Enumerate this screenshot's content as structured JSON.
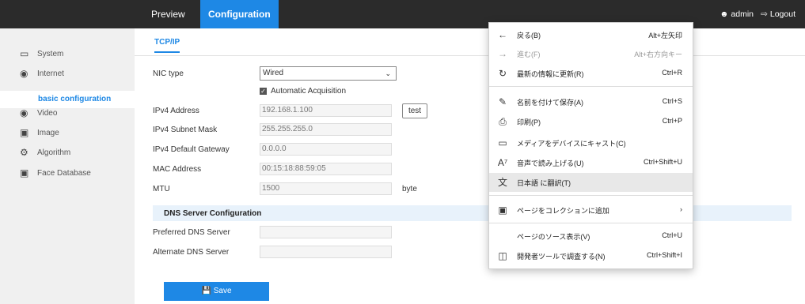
{
  "topbar": {
    "tabs": [
      {
        "label": "Preview"
      },
      {
        "label": "Configuration"
      }
    ],
    "user": "admin",
    "logout": "Logout"
  },
  "sidebar": {
    "items": [
      {
        "label": "System",
        "icon": "monitor-icon"
      },
      {
        "label": "Internet",
        "icon": "globe-icon"
      },
      {
        "label": "Video",
        "icon": "camera-icon"
      },
      {
        "label": "Image",
        "icon": "image-icon"
      },
      {
        "label": "Algorithm",
        "icon": "gears-icon"
      },
      {
        "label": "Face Database",
        "icon": "face-scan-icon"
      }
    ],
    "active_sub": "basic configuration"
  },
  "subtab": "TCP/IP",
  "form": {
    "nic_label": "NIC type",
    "nic_value": "Wired",
    "auto_label": "Automatic Acquisition",
    "ipv4_label": "IPv4 Address",
    "ipv4_value": "192.168.1.100",
    "test_label": "test",
    "mask_label": "IPv4 Subnet Mask",
    "mask_value": "255.255.255.0",
    "gateway_label": "IPv4 Default Gateway",
    "gateway_value": "0.0.0.0",
    "mac_label": "MAC Address",
    "mac_value": "00:15:18:88:59:05",
    "mtu_label": "MTU",
    "mtu_value": "1500",
    "mtu_unit": "byte",
    "dns_title": "DNS Server Configuration",
    "pref_dns_label": "Preferred DNS Server",
    "pref_dns_value": "",
    "alt_dns_label": "Alternate DNS Server",
    "alt_dns_value": "",
    "save_label": "Save"
  },
  "context_menu": {
    "items": [
      {
        "label": "戻る(B)",
        "shortcut": "Alt+左矢印",
        "icon": "back-arrow-icon"
      },
      {
        "label": "進む(F)",
        "shortcut": "Alt+右方向キー",
        "icon": "forward-arrow-icon"
      },
      {
        "label": "最新の情報に更新(R)",
        "shortcut": "Ctrl+R",
        "icon": "refresh-icon"
      },
      {
        "label": "名前を付けて保存(A)",
        "shortcut": "Ctrl+S",
        "icon": "save-as-icon"
      },
      {
        "label": "印刷(P)",
        "shortcut": "Ctrl+P",
        "icon": "print-icon"
      },
      {
        "label": "メディアをデバイスにキャスト(C)",
        "shortcut": "",
        "icon": "cast-icon"
      },
      {
        "label": "音声で読み上げる(U)",
        "shortcut": "Ctrl+Shift+U",
        "icon": "read-aloud-icon"
      },
      {
        "label": "日本語 に翻訳(T)",
        "shortcut": "",
        "icon": "translate-icon"
      },
      {
        "label": "ページをコレクションに追加",
        "shortcut": "",
        "icon": "collections-icon"
      },
      {
        "label": "ページのソース表示(V)",
        "shortcut": "Ctrl+U",
        "icon": ""
      },
      {
        "label": "開発者ツールで調査する(N)",
        "shortcut": "Ctrl+Shift+I",
        "icon": "devtools-icon"
      }
    ]
  },
  "colors": {
    "accent": "#1e88e5",
    "topbar": "#2b2b2b",
    "sidebar": "#f0f0f0"
  }
}
